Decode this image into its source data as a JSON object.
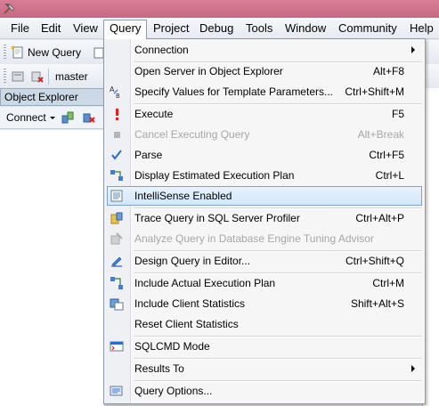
{
  "window": {
    "icon": "tools-app-icon"
  },
  "menubar": {
    "items": [
      {
        "label": "File"
      },
      {
        "label": "Edit"
      },
      {
        "label": "View"
      },
      {
        "label": "Query"
      },
      {
        "label": "Project"
      },
      {
        "label": "Debug"
      },
      {
        "label": "Tools"
      },
      {
        "label": "Window"
      },
      {
        "label": "Community"
      },
      {
        "label": "Help"
      }
    ],
    "active": "Query"
  },
  "toolbar1": {
    "new_query": "New Query"
  },
  "toolbar2": {
    "database": "master"
  },
  "object_explorer": {
    "title": "Object Explorer",
    "connect": "Connect"
  },
  "query_menu": {
    "items": [
      {
        "label": "Connection",
        "shortcut": "",
        "submenu": true,
        "icon": "",
        "disabled": false
      },
      {
        "label": "Open Server in Object Explorer",
        "shortcut": "Alt+F8",
        "icon": "",
        "disabled": false
      },
      {
        "label": "Specify Values for Template Parameters...",
        "shortcut": "Ctrl+Shift+M",
        "icon": "template-params-icon",
        "disabled": false
      },
      {
        "label": "Execute",
        "shortcut": "F5",
        "icon": "execute-icon",
        "disabled": false
      },
      {
        "label": "Cancel Executing Query",
        "shortcut": "Alt+Break",
        "icon": "stop-icon",
        "disabled": true
      },
      {
        "label": "Parse",
        "shortcut": "Ctrl+F5",
        "icon": "checkmark-icon",
        "disabled": false
      },
      {
        "label": "Display Estimated Execution Plan",
        "shortcut": "Ctrl+L",
        "icon": "execution-plan-icon",
        "disabled": false
      },
      {
        "label": "IntelliSense Enabled",
        "shortcut": "",
        "icon": "intellisense-icon",
        "disabled": false,
        "highlighted": true
      },
      {
        "label": "Trace Query in SQL Server Profiler",
        "shortcut": "Ctrl+Alt+P",
        "icon": "profiler-icon",
        "disabled": false
      },
      {
        "label": "Analyze Query in Database Engine Tuning Advisor",
        "shortcut": "",
        "icon": "tuning-advisor-icon",
        "disabled": true
      },
      {
        "label": "Design Query in Editor...",
        "shortcut": "Ctrl+Shift+Q",
        "icon": "design-query-icon",
        "disabled": false
      },
      {
        "label": "Include Actual Execution Plan",
        "shortcut": "Ctrl+M",
        "icon": "actual-plan-icon",
        "disabled": false
      },
      {
        "label": "Include Client Statistics",
        "shortcut": "Shift+Alt+S",
        "icon": "client-stats-icon",
        "disabled": false
      },
      {
        "label": "Reset Client Statistics",
        "shortcut": "",
        "icon": "",
        "disabled": false
      },
      {
        "label": "SQLCMD Mode",
        "shortcut": "",
        "icon": "sqlcmd-icon",
        "disabled": false
      },
      {
        "label": "Results To",
        "shortcut": "",
        "submenu": true,
        "icon": "",
        "disabled": false
      },
      {
        "label": "Query Options...",
        "shortcut": "",
        "icon": "query-options-icon",
        "disabled": false
      }
    ]
  }
}
